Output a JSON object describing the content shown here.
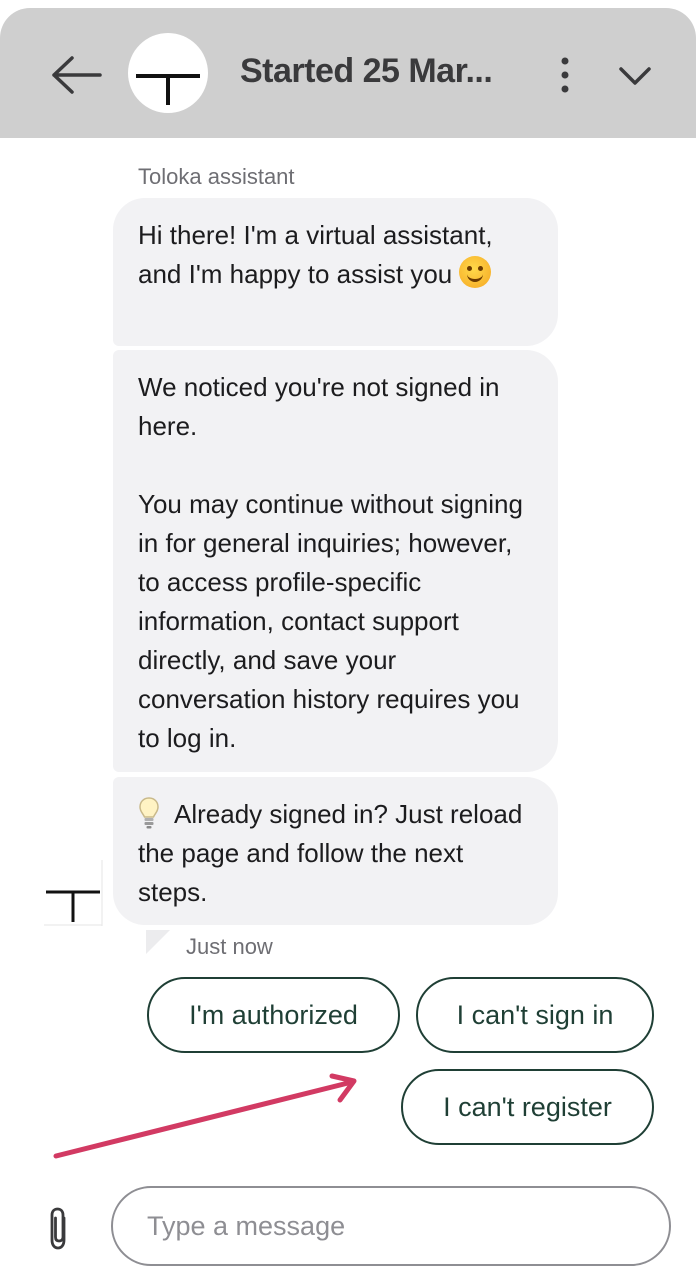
{
  "header": {
    "title": "Started 25 Mar...",
    "back_icon": "arrow-left-icon",
    "more_icon": "more-vertical-icon",
    "collapse_icon": "chevron-down-icon",
    "avatar_icon": "toloka-logo-icon",
    "background": "#cfcfcf"
  },
  "chat": {
    "sender": "Toloka assistant",
    "messages": [
      {
        "text": "Hi there! I'm a virtual assistant, and I'm happy to assist you",
        "emoji": "smiling-face-icon"
      },
      {
        "text": "We noticed you're not signed in here.\n\nYou may continue without signing in for general inquiries; however, to access profile-specific information, contact support directly, and save your conversation history requires you to log in."
      },
      {
        "icon": "lightbulb-icon",
        "text": "Already signed in? Just reload the page and follow the next steps."
      }
    ],
    "timestamp": "Just now",
    "bubble_color": "#f2f2f4"
  },
  "quick_replies": [
    {
      "label": "I'm authorized"
    },
    {
      "label": "I can't sign in"
    },
    {
      "label": "I can't register"
    }
  ],
  "quick_reply_color": "#1f3f35",
  "annotation": {
    "icon": "arrow-annotation",
    "color": "#d23a63"
  },
  "composer": {
    "placeholder": "Type a message",
    "attach_icon": "paperclip-icon"
  }
}
